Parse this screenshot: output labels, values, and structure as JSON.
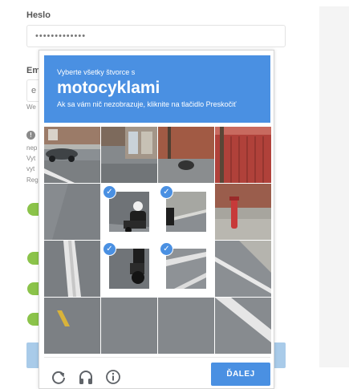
{
  "form": {
    "password_label": "Heslo",
    "password_value": "•••••••••••••",
    "email_label_clip": "Em",
    "email_input_clip": "e",
    "email_hint_clip": "We",
    "info_lines_clip": [
      "nep",
      "Vyt",
      "vyt",
      "Reg"
    ]
  },
  "captcha": {
    "instruction": "Vyberte všetky štvorce s",
    "target_object": "motocyklami",
    "skip_hint": "Ak sa vám nič nezobrazuje, kliknite na tlačidlo Preskočiť",
    "next_label": "ĎALEJ",
    "selected_tiles": [
      5,
      6,
      9,
      10
    ],
    "icons": [
      "reload-icon",
      "headphones-icon",
      "info-icon"
    ]
  },
  "colors": {
    "accent": "#4a90e2",
    "toggle_green": "#8bc34a"
  }
}
